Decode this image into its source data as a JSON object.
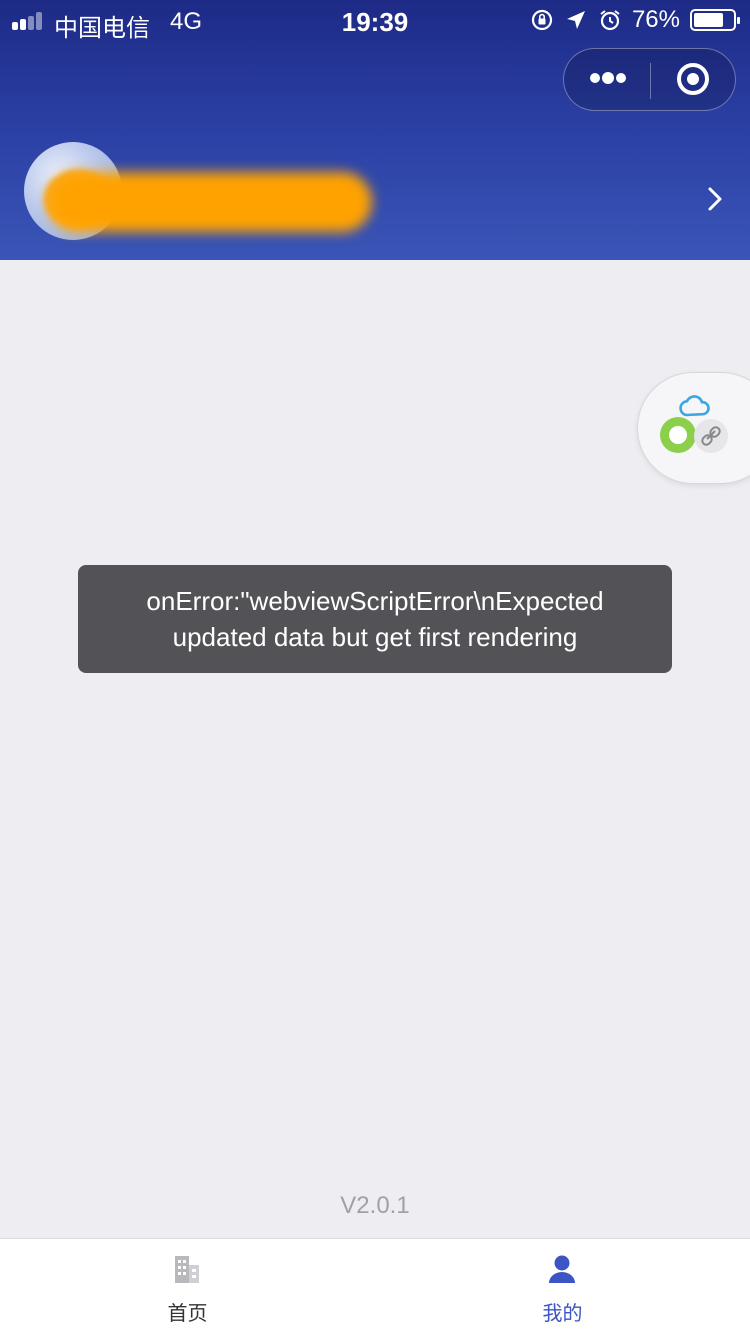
{
  "status_bar": {
    "carrier": "中国电信",
    "network": "4G",
    "time": "19:39",
    "battery_percent": "76%",
    "battery_level": 0.76,
    "icons": [
      "signal-icon",
      "rotation-lock-icon",
      "location-arrow-icon",
      "alarm-icon",
      "battery-icon"
    ]
  },
  "header": {
    "capsule": {
      "more_icon": "more-dots-icon",
      "close_icon": "target-close-icon"
    },
    "profile": {
      "chevron_icon": "chevron-right-icon"
    }
  },
  "floating_widget": {
    "icons": [
      "cloud-icon",
      "green-app-icon",
      "link-icon"
    ]
  },
  "toast": {
    "line1": "onError:\"webviewScriptError\\nExpected",
    "line2": "updated data but get first rendering"
  },
  "version": "V2.0.1",
  "tabbar": {
    "tabs": [
      {
        "label": "首页",
        "icon": "building-icon",
        "active": false,
        "color": "#9a9aa0"
      },
      {
        "label": "我的",
        "icon": "user-icon",
        "active": true,
        "color": "#3b55c4"
      }
    ]
  },
  "colors": {
    "header_top": "#1d2a86",
    "header_bottom": "#3a55b7",
    "accent": "#3b55c4",
    "name_blur": "#ffa200",
    "background": "#eeeef2"
  }
}
